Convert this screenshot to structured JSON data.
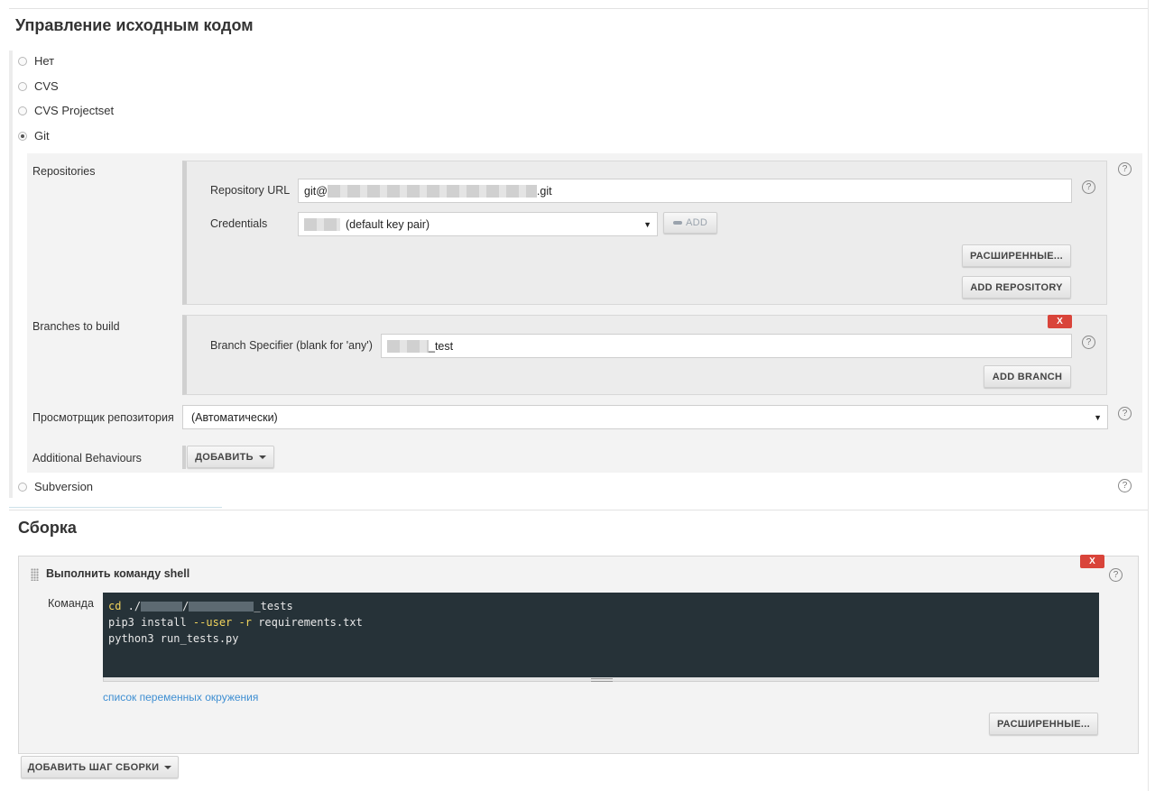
{
  "scm": {
    "title": "Управление исходным кодом",
    "options": [
      "Нет",
      "CVS",
      "CVS Projectset",
      "Git",
      "Subversion"
    ],
    "selected": "Git"
  },
  "git": {
    "repositories_label": "Repositories",
    "repo_url_label": "Repository URL",
    "repo_url_prefix": "git@",
    "repo_url_suffix": ".git",
    "credentials_label": "Credentials",
    "credentials_value": "(default key pair)",
    "add_credentials_label": "ADD",
    "advanced_label": "РАСШИРЕННЫЕ...",
    "add_repository_label": "ADD REPOSITORY",
    "branches_label": "Branches to build",
    "branch_specifier_label": "Branch Specifier (blank for 'any')",
    "branch_value": "_test",
    "delete_label": "X",
    "add_branch_label": "ADD BRANCH",
    "browser_label": "Просмотрщик репозитория",
    "browser_value": "(Автоматически)",
    "behaviours_label": "Additional Behaviours",
    "add_behaviour_label": "ДОБАВИТЬ"
  },
  "build": {
    "title": "Сборка",
    "step_title": "Выполнить команду shell",
    "command_label": "Команда",
    "code_lines": {
      "line1_kw": "cd",
      "line1_rest_a": " ./",
      "line1_rest_b": "/",
      "line1_rest_c": "_tests",
      "line2_a": "pip3 install ",
      "line2_opt1": "--user",
      "line2_b": " ",
      "line2_opt2": "-r",
      "line2_c": " requirements.txt",
      "line3": "python3 run_tests.py"
    },
    "env_link": "список переменных окружения",
    "advanced_label": "РАСШИРЕННЫЕ...",
    "delete_label": "X",
    "add_step_label": "ДОБАВИТЬ ШАГ СБОРКИ"
  },
  "icons": {
    "help": "?",
    "key": "key-icon",
    "caret": "caret-down-icon",
    "select_arrow": "▼"
  }
}
